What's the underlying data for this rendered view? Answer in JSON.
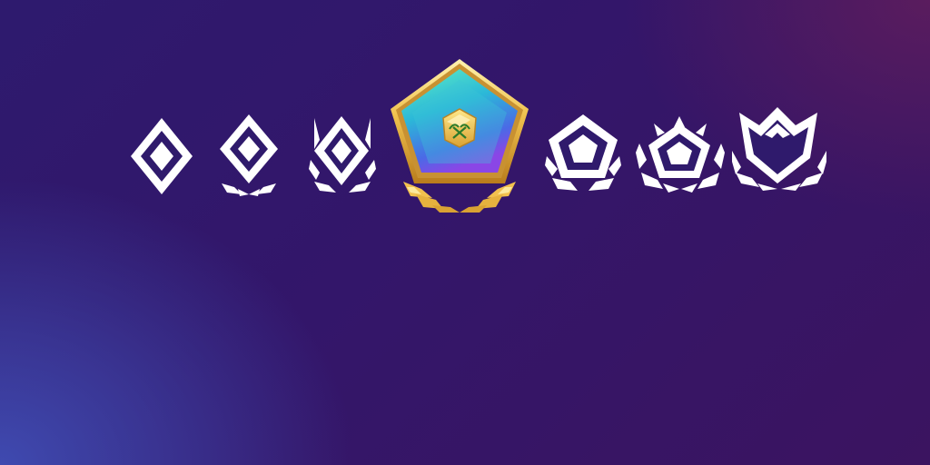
{
  "scene": {
    "background_colors": [
      "#2e1a6e",
      "#3f4ab0",
      "#5a1c5e"
    ]
  },
  "ranks": [
    {
      "icon": "rank-diamond-1-icon",
      "color": "#ffffff",
      "featured": false
    },
    {
      "icon": "rank-diamond-laurel-icon",
      "color": "#ffffff",
      "featured": false
    },
    {
      "icon": "rank-diamond-spiked-icon",
      "color": "#ffffff",
      "featured": false
    },
    {
      "icon": "rank-gold-pentagon-pickaxe-icon",
      "color": "#e7b84a",
      "featured": true
    },
    {
      "icon": "rank-pentagon-icon",
      "color": "#ffffff",
      "featured": false
    },
    {
      "icon": "rank-pentagon-spiked-icon",
      "color": "#ffffff",
      "featured": false
    },
    {
      "icon": "rank-crown-icon",
      "color": "#ffffff",
      "featured": false
    }
  ]
}
